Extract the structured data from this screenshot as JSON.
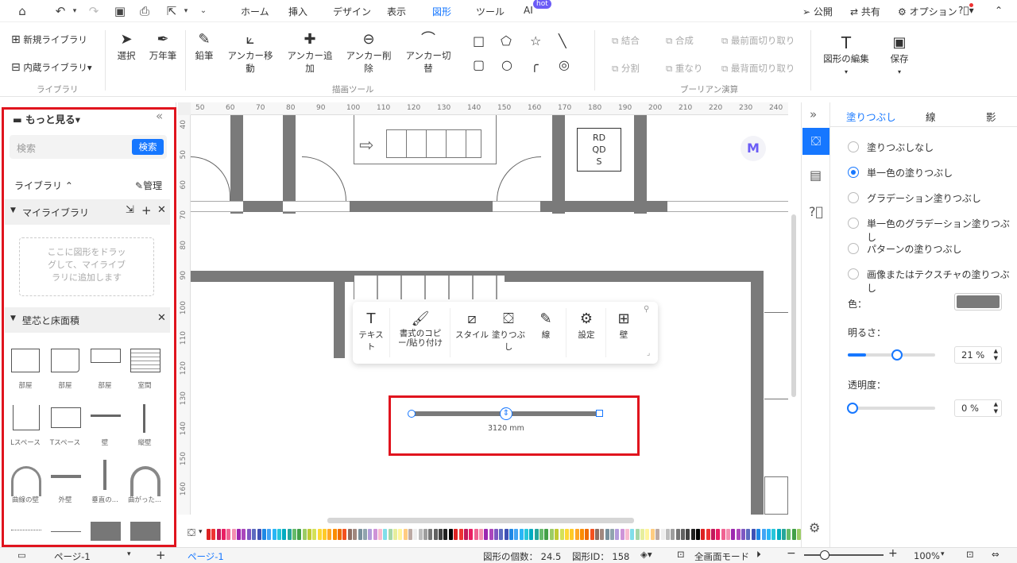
{
  "menubar": {
    "tabs": [
      "ホーム",
      "挿入",
      "デザイン",
      "表示",
      "図形",
      "ツール",
      "AI"
    ],
    "hot": "hot",
    "publish": "公開",
    "share": "共有",
    "options": "オプション"
  },
  "ribbon": {
    "lib_new": "新規ライブラリ",
    "lib_builtin": "内蔵ライブラリ",
    "group_library": "ライブラリ",
    "select": "選択",
    "pen": "万年筆",
    "pencil": "鉛筆",
    "anchor_move": "アンカー移動",
    "anchor_add": "アンカー追加",
    "anchor_del": "アンカー削除",
    "anchor_toggle": "アンカー切替",
    "group_draw": "描画ツール",
    "union": "結合",
    "combine": "合成",
    "front_cut": "最前面切り取り",
    "split": "分割",
    "overlap": "重なり",
    "back_cut": "最背面切り取り",
    "group_boolean": "ブーリアン演算",
    "edit_shape": "図形の編集",
    "save": "保存"
  },
  "left": {
    "more": "もっと見る",
    "search_placeholder": "検索",
    "search_btn": "検索",
    "library": "ライブラリ",
    "manage": "管理",
    "mylib": "マイライブラリ",
    "drop_hint": "ここに図形をドラッグして、マイライブラリに追加します",
    "section": "壁芯と床面積",
    "items": [
      "部屋",
      "部屋",
      "部屋",
      "室間",
      "Lスペース",
      "Tスペース",
      "壁",
      "縦壁",
      "曲線の壁",
      "外壁",
      "垂直の...",
      "曲がった..."
    ]
  },
  "ruler": {
    "h": [
      "50",
      "60",
      "70",
      "80",
      "90",
      "100",
      "110",
      "120",
      "130",
      "140",
      "150",
      "160",
      "170",
      "180",
      "190",
      "200",
      "210",
      "220",
      "230",
      "240"
    ],
    "v": [
      "40",
      "50",
      "60",
      "70",
      "80",
      "90",
      "100",
      "110",
      "120",
      "130",
      "140",
      "150",
      "160"
    ]
  },
  "canvas": {
    "rdqds": [
      "RD",
      "QD",
      "S"
    ],
    "dimension": "3120 mm"
  },
  "floatbar": {
    "text": "テキスト",
    "format_copy": "書式のコピー/貼り付け",
    "style": "スタイル",
    "fill": "塗りつぶし",
    "line": "線",
    "settings": "設定",
    "wall": "壁"
  },
  "right": {
    "tabs": [
      "塗りつぶし",
      "線",
      "影"
    ],
    "options": [
      "塗りつぶしなし",
      "単一色の塗りつぶし",
      "グラデーション塗りつぶし",
      "単一色のグラデーション塗りつぶし",
      "パターンの塗りつぶし",
      "画像またはテクスチャの塗りつぶし"
    ],
    "selected_option": "単一色の塗りつぶし",
    "color_label": "色：",
    "color_value": "#7a7a7a",
    "brightness_label": "明るさ：",
    "brightness": "21 %",
    "brightness_fraction": 0.21,
    "opacity_label": "透明度：",
    "opacity": "0 %",
    "opacity_fraction": 0.0
  },
  "status": {
    "page_sel": "ページ-1",
    "page_tab": "ページ-1",
    "shape_count": "図形の個数： 24.5",
    "shape_id": "図形ID： 158",
    "fullscreen": "全画面モード",
    "zoom": "100%"
  },
  "colors": {
    "accent": "#1677ff",
    "red": "#e0141e",
    "wall": "#7a7a7a"
  }
}
